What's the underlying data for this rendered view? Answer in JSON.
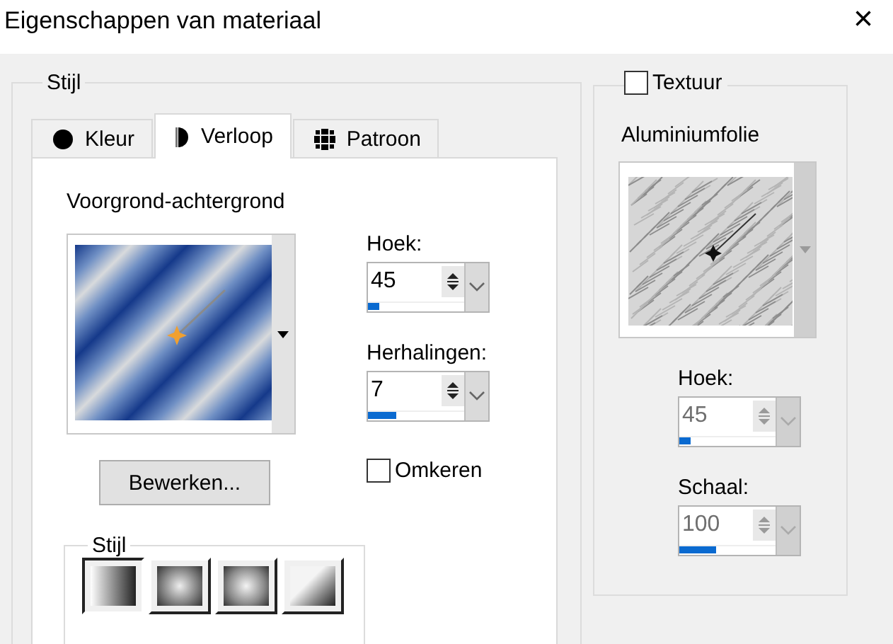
{
  "window": {
    "title": "Eigenschappen van materiaal",
    "close": "×"
  },
  "style_group": {
    "legend": "Stijl",
    "tabs": [
      {
        "label": "Kleur",
        "kind": "color",
        "selected": false
      },
      {
        "label": "Verloop",
        "kind": "gradient",
        "selected": true
      },
      {
        "label": "Patroon",
        "kind": "pattern",
        "selected": false
      }
    ]
  },
  "gradient": {
    "name": "Voorgrond-achtergrond",
    "angle": {
      "label": "Hoek:",
      "value": "45",
      "level": 0.12,
      "disabled": false
    },
    "repeats": {
      "label": "Herhalingen:",
      "value": "7",
      "level": 0.3,
      "disabled": false
    },
    "edit_button": "Bewerken...",
    "reverse": {
      "label": "Omkeren",
      "checked": false
    },
    "style": {
      "legend": "Stijl",
      "options": [
        {
          "kind": "linear",
          "selected": true
        },
        {
          "kind": "rectangular",
          "selected": false
        },
        {
          "kind": "sunburst",
          "selected": false
        },
        {
          "kind": "corner",
          "selected": false
        }
      ]
    }
  },
  "texture": {
    "label": "Textuur",
    "checked": false,
    "name": "Aluminiumfolie",
    "angle": {
      "label": "Hoek:",
      "value": "45",
      "level": 0.12,
      "disabled": true
    },
    "scale": {
      "label": "Schaal:",
      "value": "100",
      "level": 0.38,
      "disabled": true
    }
  }
}
